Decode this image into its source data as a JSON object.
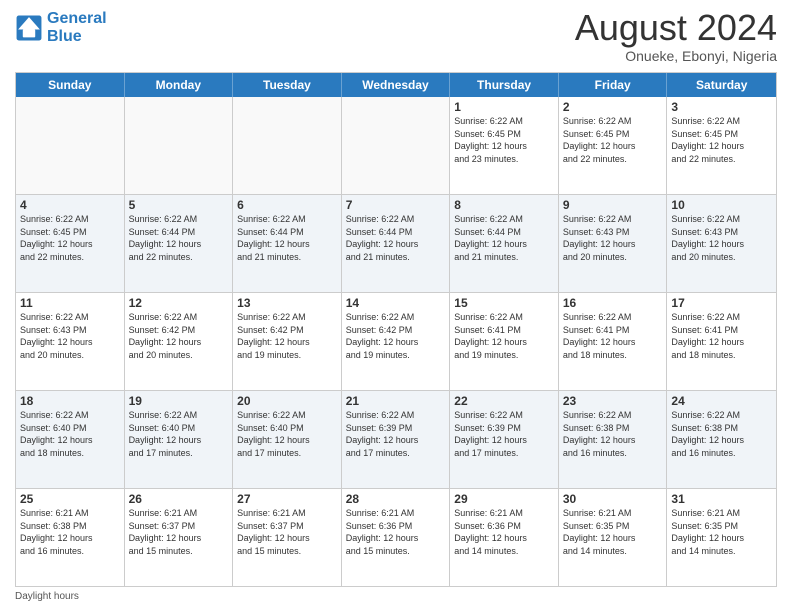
{
  "logo": {
    "line1": "General",
    "line2": "Blue"
  },
  "title": "August 2024",
  "location": "Onueke, Ebonyi, Nigeria",
  "days_of_week": [
    "Sunday",
    "Monday",
    "Tuesday",
    "Wednesday",
    "Thursday",
    "Friday",
    "Saturday"
  ],
  "footer": "Daylight hours",
  "rows": [
    [
      {
        "day": "",
        "detail": "",
        "empty": true
      },
      {
        "day": "",
        "detail": "",
        "empty": true
      },
      {
        "day": "",
        "detail": "",
        "empty": true
      },
      {
        "day": "",
        "detail": "",
        "empty": true
      },
      {
        "day": "1",
        "detail": "Sunrise: 6:22 AM\nSunset: 6:45 PM\nDaylight: 12 hours\nand 23 minutes."
      },
      {
        "day": "2",
        "detail": "Sunrise: 6:22 AM\nSunset: 6:45 PM\nDaylight: 12 hours\nand 22 minutes."
      },
      {
        "day": "3",
        "detail": "Sunrise: 6:22 AM\nSunset: 6:45 PM\nDaylight: 12 hours\nand 22 minutes."
      }
    ],
    [
      {
        "day": "4",
        "detail": "Sunrise: 6:22 AM\nSunset: 6:45 PM\nDaylight: 12 hours\nand 22 minutes."
      },
      {
        "day": "5",
        "detail": "Sunrise: 6:22 AM\nSunset: 6:44 PM\nDaylight: 12 hours\nand 22 minutes."
      },
      {
        "day": "6",
        "detail": "Sunrise: 6:22 AM\nSunset: 6:44 PM\nDaylight: 12 hours\nand 21 minutes."
      },
      {
        "day": "7",
        "detail": "Sunrise: 6:22 AM\nSunset: 6:44 PM\nDaylight: 12 hours\nand 21 minutes."
      },
      {
        "day": "8",
        "detail": "Sunrise: 6:22 AM\nSunset: 6:44 PM\nDaylight: 12 hours\nand 21 minutes."
      },
      {
        "day": "9",
        "detail": "Sunrise: 6:22 AM\nSunset: 6:43 PM\nDaylight: 12 hours\nand 20 minutes."
      },
      {
        "day": "10",
        "detail": "Sunrise: 6:22 AM\nSunset: 6:43 PM\nDaylight: 12 hours\nand 20 minutes."
      }
    ],
    [
      {
        "day": "11",
        "detail": "Sunrise: 6:22 AM\nSunset: 6:43 PM\nDaylight: 12 hours\nand 20 minutes."
      },
      {
        "day": "12",
        "detail": "Sunrise: 6:22 AM\nSunset: 6:42 PM\nDaylight: 12 hours\nand 20 minutes."
      },
      {
        "day": "13",
        "detail": "Sunrise: 6:22 AM\nSunset: 6:42 PM\nDaylight: 12 hours\nand 19 minutes."
      },
      {
        "day": "14",
        "detail": "Sunrise: 6:22 AM\nSunset: 6:42 PM\nDaylight: 12 hours\nand 19 minutes."
      },
      {
        "day": "15",
        "detail": "Sunrise: 6:22 AM\nSunset: 6:41 PM\nDaylight: 12 hours\nand 19 minutes."
      },
      {
        "day": "16",
        "detail": "Sunrise: 6:22 AM\nSunset: 6:41 PM\nDaylight: 12 hours\nand 18 minutes."
      },
      {
        "day": "17",
        "detail": "Sunrise: 6:22 AM\nSunset: 6:41 PM\nDaylight: 12 hours\nand 18 minutes."
      }
    ],
    [
      {
        "day": "18",
        "detail": "Sunrise: 6:22 AM\nSunset: 6:40 PM\nDaylight: 12 hours\nand 18 minutes."
      },
      {
        "day": "19",
        "detail": "Sunrise: 6:22 AM\nSunset: 6:40 PM\nDaylight: 12 hours\nand 17 minutes."
      },
      {
        "day": "20",
        "detail": "Sunrise: 6:22 AM\nSunset: 6:40 PM\nDaylight: 12 hours\nand 17 minutes."
      },
      {
        "day": "21",
        "detail": "Sunrise: 6:22 AM\nSunset: 6:39 PM\nDaylight: 12 hours\nand 17 minutes."
      },
      {
        "day": "22",
        "detail": "Sunrise: 6:22 AM\nSunset: 6:39 PM\nDaylight: 12 hours\nand 17 minutes."
      },
      {
        "day": "23",
        "detail": "Sunrise: 6:22 AM\nSunset: 6:38 PM\nDaylight: 12 hours\nand 16 minutes."
      },
      {
        "day": "24",
        "detail": "Sunrise: 6:22 AM\nSunset: 6:38 PM\nDaylight: 12 hours\nand 16 minutes."
      }
    ],
    [
      {
        "day": "25",
        "detail": "Sunrise: 6:21 AM\nSunset: 6:38 PM\nDaylight: 12 hours\nand 16 minutes."
      },
      {
        "day": "26",
        "detail": "Sunrise: 6:21 AM\nSunset: 6:37 PM\nDaylight: 12 hours\nand 15 minutes."
      },
      {
        "day": "27",
        "detail": "Sunrise: 6:21 AM\nSunset: 6:37 PM\nDaylight: 12 hours\nand 15 minutes."
      },
      {
        "day": "28",
        "detail": "Sunrise: 6:21 AM\nSunset: 6:36 PM\nDaylight: 12 hours\nand 15 minutes."
      },
      {
        "day": "29",
        "detail": "Sunrise: 6:21 AM\nSunset: 6:36 PM\nDaylight: 12 hours\nand 14 minutes."
      },
      {
        "day": "30",
        "detail": "Sunrise: 6:21 AM\nSunset: 6:35 PM\nDaylight: 12 hours\nand 14 minutes."
      },
      {
        "day": "31",
        "detail": "Sunrise: 6:21 AM\nSunset: 6:35 PM\nDaylight: 12 hours\nand 14 minutes."
      }
    ]
  ]
}
